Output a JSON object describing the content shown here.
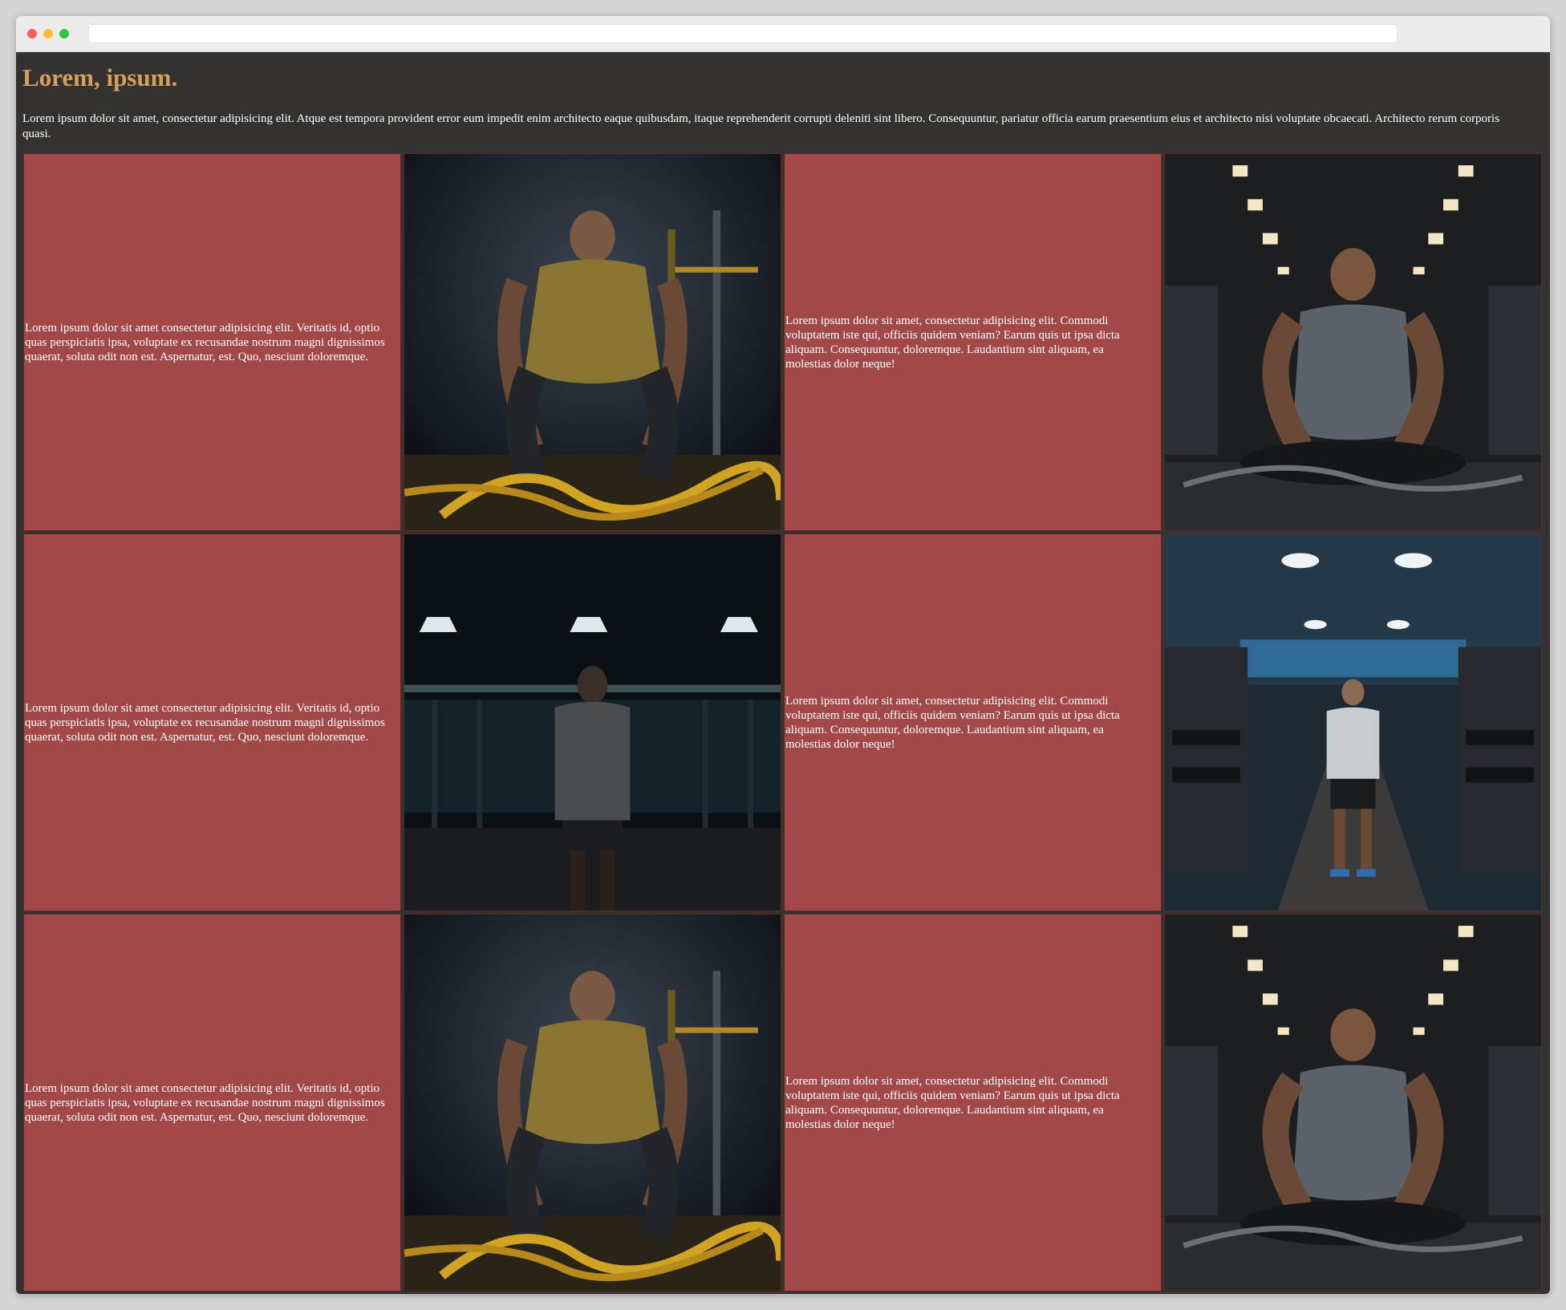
{
  "page": {
    "title": "Lorem, ipsum.",
    "intro": "Lorem ipsum dolor sit amet, consectetur adipisicing elit. Atque est tempora provident error eum impedit enim architecto eaque quibusdam, itaque reprehenderit corrupti deleniti sint libero. Consequuntur, pariatur officia earum praesentium eius et architecto nisi voluptate obcaecati. Architecto rerum corporis quasi."
  },
  "grid": {
    "rows": [
      {
        "text_a": "Lorem ipsum dolor sit amet consectetur adipisicing elit. Veritatis id, optio quas perspiciatis ipsa, voluptate ex recusandae nostrum magni dignissimos quaerat, soluta odit non est. Aspernatur, est. Quo, nesciunt doloremque.",
        "image_a": "man-with-battle-ropes",
        "text_b": "Lorem ipsum dolor sit amet, consectetur adipisicing elit. Commodi voluptatem iste qui, officiis quidem veniam? Earum quis ut ipsa dicta aliquam. Consequuntur, doloremque. Laudantium sint aliquam, ea molestias dolor neque!",
        "image_b": "man-seated-in-gym"
      },
      {
        "text_a": "Lorem ipsum dolor sit amet consectetur adipisicing elit. Veritatis id, optio quas perspiciatis ipsa, voluptate ex recusandae nostrum magni dignissimos quaerat, soluta odit non est. Aspernatur, est. Quo, nesciunt doloremque.",
        "image_a": "man-standing-in-dark-gym",
        "text_b": "Lorem ipsum dolor sit amet, consectetur adipisicing elit. Commodi voluptatem iste qui, officiis quidem veniam? Earum quis ut ipsa dicta aliquam. Consequuntur, doloremque. Laudantium sint aliquam, ea molestias dolor neque!",
        "image_b": "man-in-gym-aisle"
      },
      {
        "text_a": "Lorem ipsum dolor sit amet consectetur adipisicing elit. Veritatis id, optio quas perspiciatis ipsa, voluptate ex recusandae nostrum magni dignissimos quaerat, soluta odit non est. Aspernatur, est. Quo, nesciunt doloremque.",
        "image_a": "man-with-battle-ropes",
        "text_b": "Lorem ipsum dolor sit amet, consectetur adipisicing elit. Commodi voluptatem iste qui, officiis quidem veniam? Earum quis ut ipsa dicta aliquam. Consequuntur, doloremque. Laudantium sint aliquam, ea molestias dolor neque!",
        "image_b": "man-seated-in-gym"
      }
    ]
  },
  "colors": {
    "page_bg": "#333231",
    "title": "#d6a05c",
    "cell_bg": "#a34848",
    "text": "#ffffff"
  }
}
